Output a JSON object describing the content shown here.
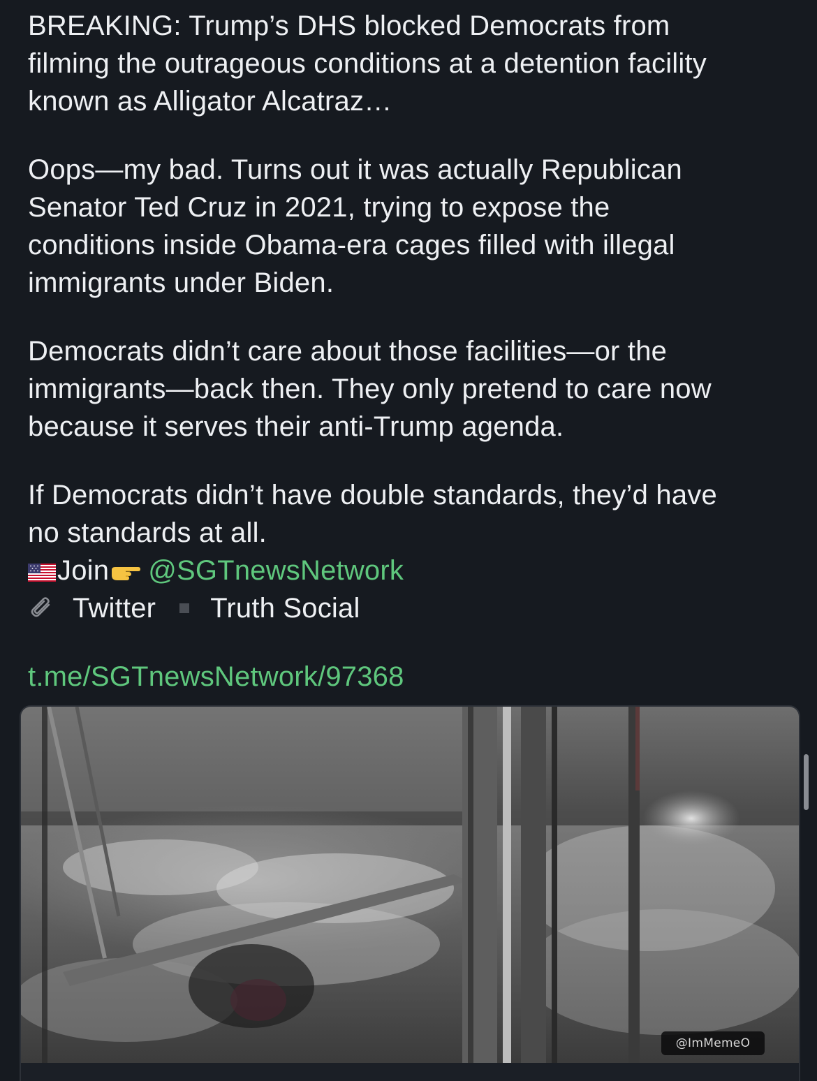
{
  "post": {
    "paragraph1": [
      "BREAKING: Trump’s DHS blocked Democrats from",
      "filming the outrageous conditions at a detention facility",
      "known as Alligator Alcatraz…"
    ],
    "paragraph2": [
      "Oops—my bad. Turns out it was actually Republican",
      "Senator Ted Cruz in 2021, trying to expose the",
      "conditions inside Obama-era cages filled with illegal",
      "immigrants under Biden."
    ],
    "paragraph3": [
      "Democrats didn’t care about those facilities—or the",
      "immigrants—back then. They only pretend to care now",
      "because it serves their anti-Trump agenda."
    ],
    "paragraph4": [
      "If Democrats didn’t have double standards, they’d have",
      "no standards at all."
    ],
    "join_label": "Join",
    "handle": "@SGTnewsNetwork",
    "twitter_label": "Twitter",
    "truth_social_label": "Truth Social",
    "post_url": "t.me/SGTnewsNetwork/97368"
  },
  "media": {
    "watermark": "@ImMemeO"
  },
  "colors": {
    "background": "#161a20",
    "text": "#eef0f3",
    "link": "#5fc77d"
  },
  "icons": [
    "us-flag-icon",
    "pointing-hand-icon",
    "paperclip-icon"
  ]
}
